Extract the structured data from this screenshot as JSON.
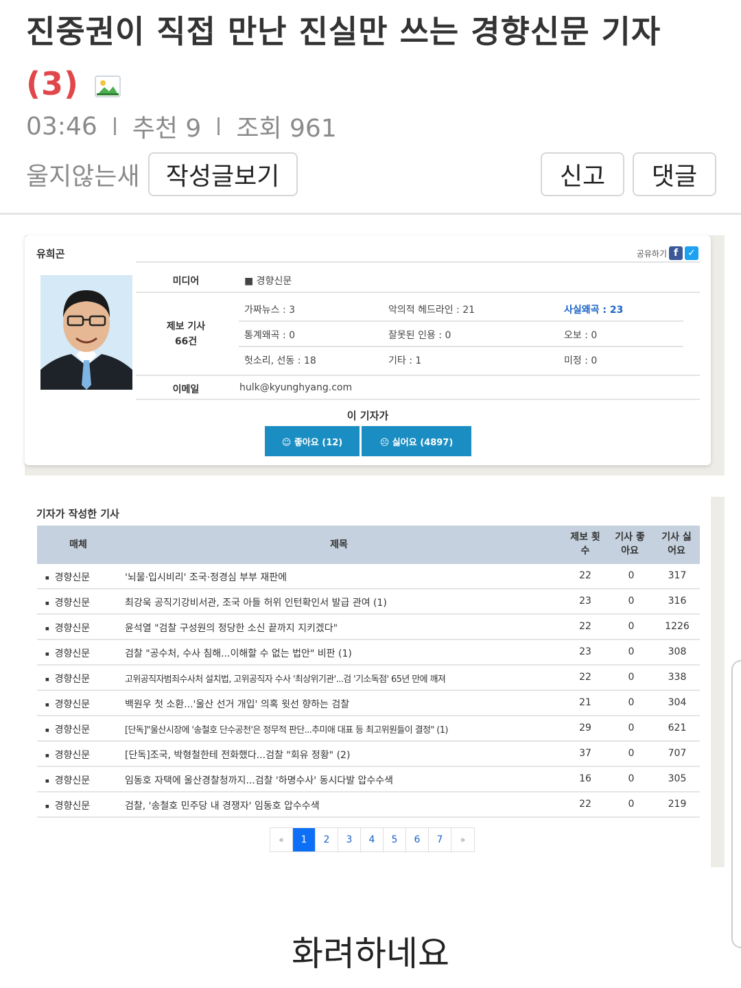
{
  "post": {
    "title": "진중권이 직접 만난 진실만 쓰는 경향신문 기자",
    "comment_count": "(3)",
    "icon": "image-icon",
    "time": "03:46",
    "recommend": "추천 9",
    "views": "조회 961",
    "author": "울지않는새",
    "view_posts_label": "작성글보기",
    "report_label": "신고",
    "comment_label": "댓글",
    "caption": "화려하네요"
  },
  "profile": {
    "name": "유희곤",
    "share_label": "공유하기",
    "media_label": "미디어",
    "media_value": "■ 경향신문",
    "report_label": "제보 기사",
    "report_count": "66건",
    "stats": [
      "가짜뉴스 : 3",
      "악의적 헤드라인 : 21",
      "사실왜곡 : 23",
      "통계왜곡 : 0",
      "잘못된 인용 : 0",
      "오보 : 0",
      "헛소리, 선동 : 18",
      "기타 : 1",
      "미정 : 0"
    ],
    "email_label": "이메일",
    "email_value": "hulk@kyunghyang.com",
    "reaction_title": "이 기자가",
    "like_label": "☺ 좋아요 (12)",
    "dislike_label": "☹ 싫어요 (4897)",
    "colors": {
      "button": "#1a8ec2",
      "highlight": "#1b62c7"
    }
  },
  "articles": {
    "section_title": "기자가 작성한 기사",
    "headers": {
      "media": "매체",
      "title": "제목",
      "reports": "제보 횟수",
      "likes": "기사 좋아요",
      "dislikes": "기사 싫어요"
    },
    "rows": [
      {
        "media": "경향신문",
        "title": "'뇌물·입시비리' 조국·정경심 부부 재판에",
        "reports": "22",
        "likes": "0",
        "dislikes": "317"
      },
      {
        "media": "경향신문",
        "title": "최강욱 공직기강비서관, 조국 아들 허위 인턴확인서 발급 관여 (1)",
        "reports": "23",
        "likes": "0",
        "dislikes": "316"
      },
      {
        "media": "경향신문",
        "title": "윤석열 \"검찰 구성원의 정당한 소신 끝까지 지키겠다\"",
        "reports": "22",
        "likes": "0",
        "dislikes": "1226"
      },
      {
        "media": "경향신문",
        "title": "검찰 \"공수처, 수사 침해...이해할 수 없는 법안\" 비판 (1)",
        "reports": "23",
        "likes": "0",
        "dislikes": "308"
      },
      {
        "media": "경향신문",
        "title": "고위공직자범죄수사처 설치법, 고위공직자 수사 '최상위기관'...검 '기소독점' 65년 만에 깨져",
        "reports": "22",
        "likes": "0",
        "dislikes": "338"
      },
      {
        "media": "경향신문",
        "title": "백원우 첫 소환...'울산 선거 개입' 의혹 윗선 향하는 검찰",
        "reports": "21",
        "likes": "0",
        "dislikes": "304"
      },
      {
        "media": "경향신문",
        "title": "[단독]\"울산시장에 '송철호 단수공천'은 정무적 판단...추미애 대표 등 최고위원들이 결정\" (1)",
        "reports": "29",
        "likes": "0",
        "dislikes": "621"
      },
      {
        "media": "경향신문",
        "title": "[단독]조국, 박형철한테 전화했다...검찰 \"회유 정황\" (2)",
        "reports": "37",
        "likes": "0",
        "dislikes": "707"
      },
      {
        "media": "경향신문",
        "title": "임동호 자택에 울산경찰청까지...검찰 '하명수사' 동시다발 압수수색",
        "reports": "16",
        "likes": "0",
        "dislikes": "305"
      },
      {
        "media": "경향신문",
        "title": "검찰, '송철호 민주당 내 경쟁자' 임동호 압수수색",
        "reports": "22",
        "likes": "0",
        "dislikes": "219"
      }
    ],
    "pagination": [
      "«",
      "1",
      "2",
      "3",
      "4",
      "5",
      "6",
      "7",
      "»"
    ],
    "current_page": "1"
  }
}
